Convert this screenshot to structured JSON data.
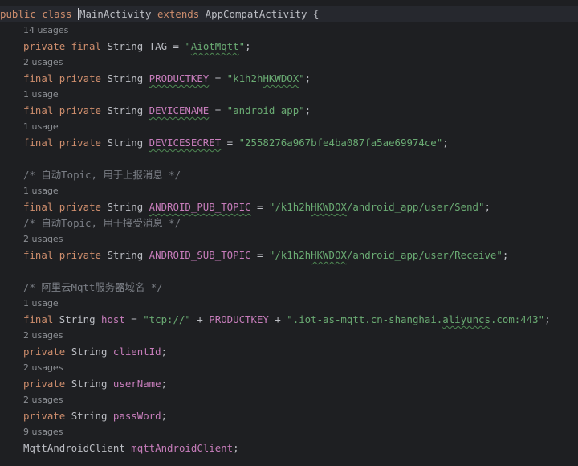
{
  "editor": {
    "class_line": {
      "modifiers": "public class ",
      "class_name": "MainActivity",
      "extends_kw": " extends ",
      "parent": "AppCompatActivity",
      "brace": " {"
    },
    "tag": {
      "usages": "14 usages",
      "modifiers": "private final ",
      "type": "String ",
      "name": "TAG",
      "eq": " = ",
      "q1": "\"",
      "value": "AiotMqtt",
      "q2": "\"",
      "end": ";"
    },
    "productkey": {
      "usages": "2 usages",
      "mod1": "final ",
      "mod2": "private ",
      "type": "String ",
      "name": "PRODUCTKEY",
      "eq": " = ",
      "q1": "\"k1h2h",
      "value": "HKWDOX",
      "q2": "\"",
      "end": ";"
    },
    "devicename": {
      "usages": "1 usage",
      "mod1": "final ",
      "mod2": "private ",
      "type": "String ",
      "name": "DEVICENAME",
      "eq": " = ",
      "value": "\"android_app\"",
      "end": ";"
    },
    "devicesecret": {
      "usages": "1 usage",
      "mod1": "final ",
      "mod2": "private ",
      "type": "String ",
      "name": "DEVICESECRET",
      "eq": " = ",
      "value": "\"2558276a967bfe4ba087fa5ae69974ce\"",
      "end": ";"
    },
    "comment_pub": "/* 自动Topic, 用于上报消息 */",
    "pub_topic": {
      "usages": "1 usage",
      "mod1": "final ",
      "mod2": "private ",
      "type": "String ",
      "name": "ANDROID_PUB_TOPIC",
      "eq": " = ",
      "v1": "\"/k1h2h",
      "v2": "HKWDOX",
      "v3": "/android_app/user/Send\"",
      "end": ";"
    },
    "comment_sub": "/* 自动Topic, 用于接受消息 */",
    "sub_topic": {
      "usages": "2 usages",
      "mod1": "final ",
      "mod2": "private ",
      "type": "String ",
      "name": "ANDROID_SUB_TOPIC",
      "eq": " = ",
      "v1": "\"/k1h2h",
      "v2": "HKWDOX",
      "v3": "/android_app/user/Receive\"",
      "end": ";"
    },
    "comment_host": "/* 阿里云Mqtt服务器域名 */",
    "host": {
      "usages": "1 usage",
      "mod1": "final ",
      "type": "String ",
      "name": "host",
      "eq": " = ",
      "v1": "\"tcp://\"",
      "plus1": " + ",
      "ref": "PRODUCTKEY",
      "plus2": " + ",
      "v2": "\".iot-as-mqtt.cn-shanghai.",
      "v3": "aliyuncs",
      "v4": ".com:443\"",
      "end": ";"
    },
    "client_id": {
      "usages": "2 usages",
      "mod": "private ",
      "type": "String ",
      "name": "clientId",
      "end": ";"
    },
    "user_name": {
      "usages": "2 usages",
      "mod": "private ",
      "type": "String ",
      "name": "userName",
      "end": ";"
    },
    "pass_word": {
      "usages": "2 usages",
      "mod": "private ",
      "type": "String ",
      "name": "passWord",
      "end": ";"
    },
    "mqtt_client": {
      "usages": "9 usages",
      "type": "MqttAndroidClient ",
      "name": "mqttAndroidClient",
      "end": ";"
    }
  },
  "colors": {
    "background": "#1e1f22",
    "keyword": "#cf8e6d",
    "field": "#c77dbb",
    "string": "#6aab73",
    "comment": "#7a7e85",
    "text": "#bcbec4",
    "usage_hint": "#8c8f94"
  }
}
